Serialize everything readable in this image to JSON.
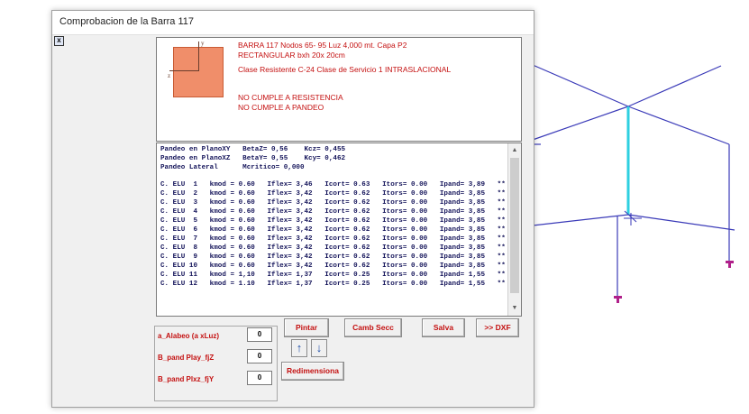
{
  "window": {
    "title": "Comprobacion de la Barra  117",
    "close_label": "x"
  },
  "section_diagram": {
    "axis_y": "y",
    "axis_z": "z",
    "fill_color": "#f08e6a"
  },
  "info": {
    "line1": "BARRA  117    Nodos 65- 95   Luz 4,000 mt.   Capa P2",
    "line2": "RECTANGULAR bxh  20x 20cm",
    "line3": "Clase Resistente   C-24    Clase de Servicio 1   INTRASLACIONAL",
    "line4": "NO CUMPLE A RESISTENCIA",
    "line5": "NO CUMPLE A PANDEO"
  },
  "results": {
    "header": [
      "Pandeo en PlanoXY   BetaZ= 0,56    Kcz= 0,455",
      "Pandeo en PlanoXZ   BetaY= 0,55    Kcy= 0,462",
      "Pandeo Lateral      Mcritico= 0,000"
    ],
    "rows": [
      "C. ELU  1   kmod = 0.60   Iflex= 3,46   Icort= 0.63   Itors= 0.00   Ipand= 3,89   **",
      "C. ELU  2   kmod = 0.60   Iflex= 3,42   Icort= 0.62   Itors= 0.00   Ipand= 3,85   **",
      "C. ELU  3   kmod = 0.60   Iflex= 3,42   Icort= 0.62   Itors= 0.00   Ipand= 3,85   **",
      "C. ELU  4   kmod = 0.60   Iflex= 3,42   Icort= 0.62   Itors= 0.00   Ipand= 3,85   **",
      "C. ELU  5   kmod = 0.60   Iflex= 3,42   Icort= 0.62   Itors= 0.00   Ipand= 3,85   **",
      "C. ELU  6   kmod = 0.60   Iflex= 3,42   Icort= 0.62   Itors= 0.00   Ipand= 3,85   **",
      "C. ELU  7   kmod = 0.60   Iflex= 3,42   Icort= 0.62   Itors= 0.00   Ipand= 3,85   **",
      "C. ELU  8   kmod = 0.60   Iflex= 3,42   Icort= 0.62   Itors= 0.00   Ipand= 3,85   **",
      "C. ELU  9   kmod = 0.60   Iflex= 3,42   Icort= 0.62   Itors= 0.00   Ipand= 3,85   **",
      "C. ELU 10   kmod = 0.60   Iflex= 3,42   Icort= 0.62   Itors= 0.00   Ipand= 3,85   **",
      "C. ELU 11   kmod = 1,10   Iflex= 1,37   Icort= 0.25   Itors= 0.00   Ipand= 1,55   **",
      "C. ELU 12   kmod = 1.10   Iflex= 1,37   Icort= 0.25   Itors= 0.00   Ipand= 1,55   **"
    ]
  },
  "controls": {
    "alabeo_label": "a_Alabeo (a xLuz)",
    "alabeo_value": "0",
    "bpand_play_label": "B_pand Play_fjZ",
    "bpand_play_value": "0",
    "bpand_plxz_label": "B_pand Plxz_fjY",
    "bpand_plxz_value": "0"
  },
  "buttons": {
    "pintar": "Pintar",
    "camb_secc": "Camb Secc",
    "salva": "Salva",
    "dxf": ">> DXF",
    "up_arrow": "↑",
    "down_arrow": "↓",
    "redimensiona": "Redimensiona"
  },
  "colors": {
    "accent_red": "#c41010",
    "frame_blue": "#3a3ab8",
    "highlight_cyan": "#2ed0e0",
    "node_purple": "#b0208a"
  }
}
